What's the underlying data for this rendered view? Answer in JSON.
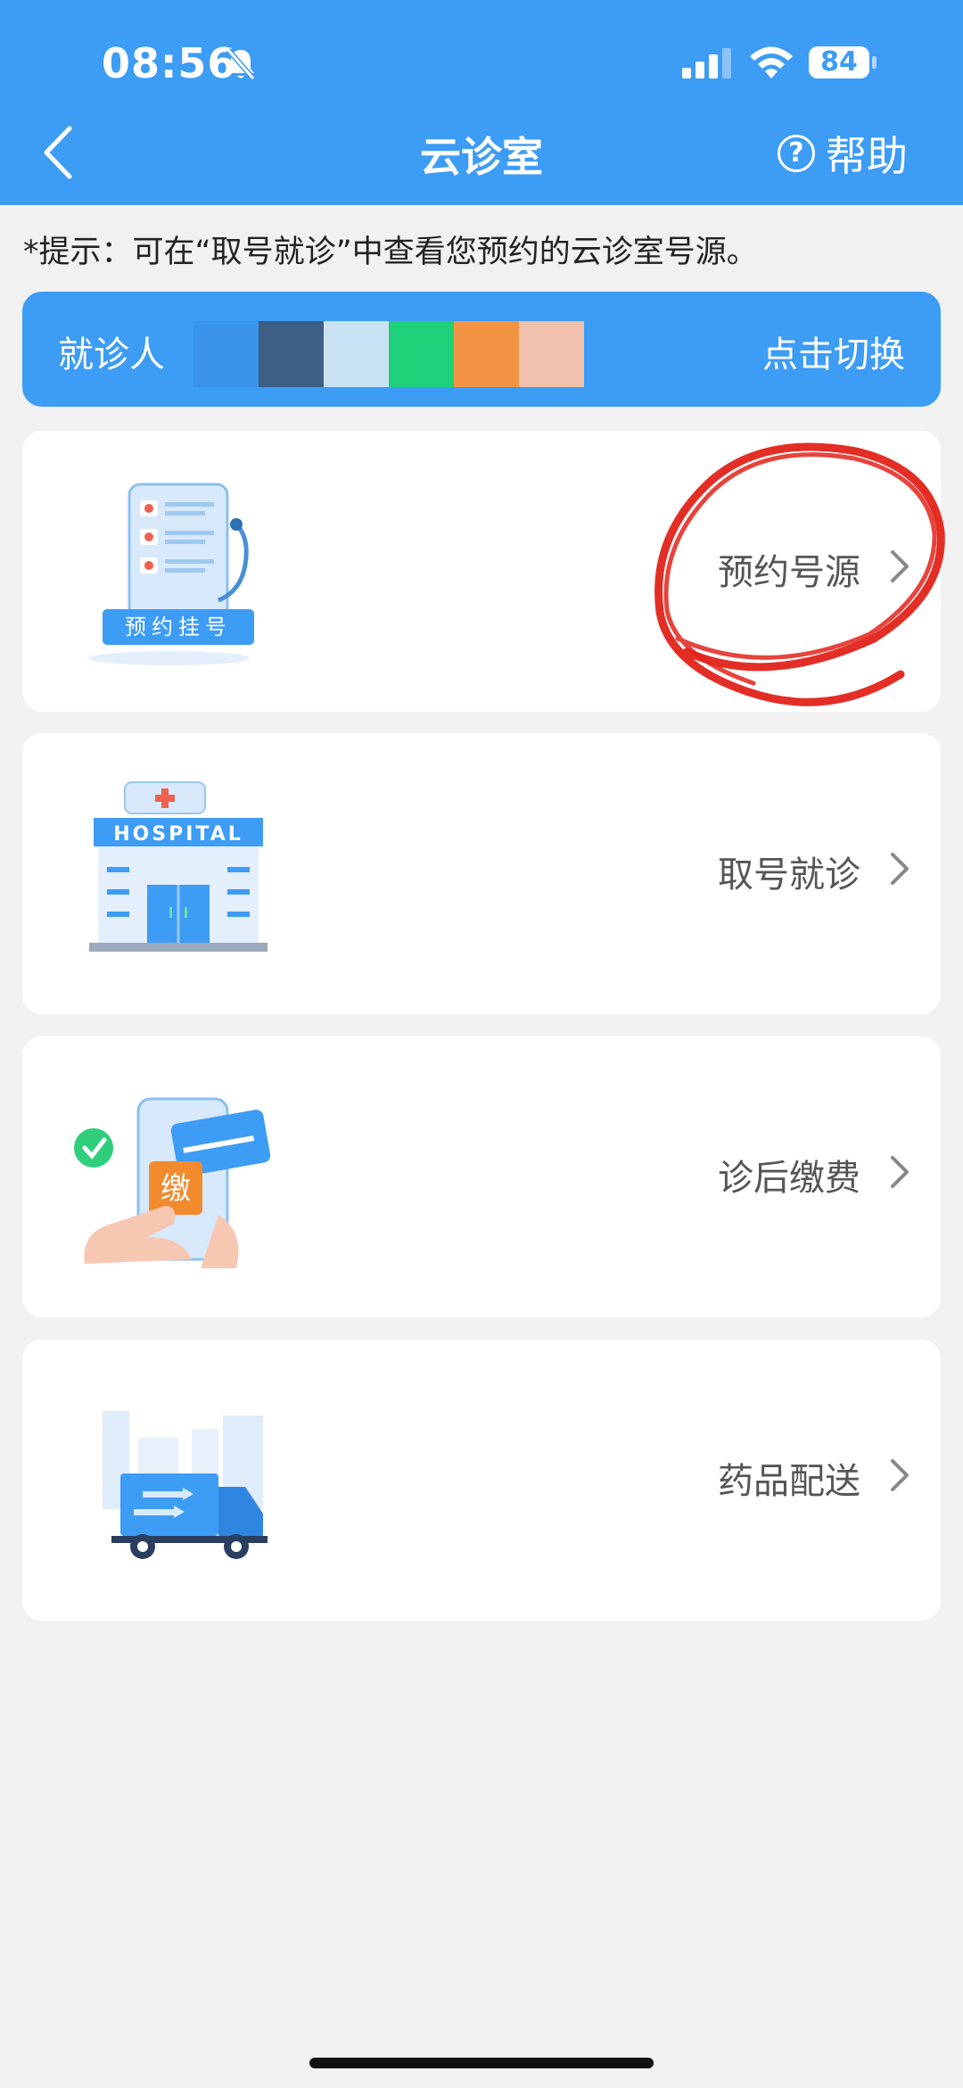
{
  "status_bar": {
    "time": "08:56",
    "battery": "84"
  },
  "nav": {
    "title": "云诊室",
    "help_label": "帮助"
  },
  "hint": "*提示：可在“取号就诊”中查看您预约的云诊室号源。",
  "patient": {
    "label": "就诊人",
    "switch_label": "点击切换",
    "redaction_colors": [
      "#3a95ea",
      "#3d5f85",
      "#c9e2f3",
      "#1fd07b",
      "#f29443",
      "#f0c1ac"
    ]
  },
  "cards": [
    {
      "label": "预约号源",
      "icon": "appointment-illustration",
      "caption": "预约挂号"
    },
    {
      "label": "取号就诊",
      "icon": "hospital-illustration",
      "caption": "HOSPITAL"
    },
    {
      "label": "诊后缴费",
      "icon": "payment-illustration",
      "caption": "缴"
    },
    {
      "label": "药品配送",
      "icon": "delivery-truck-illustration"
    }
  ],
  "colors": {
    "primary": "#3d9cf4",
    "background": "#f1f1f1",
    "annotation": "#e2231a"
  }
}
